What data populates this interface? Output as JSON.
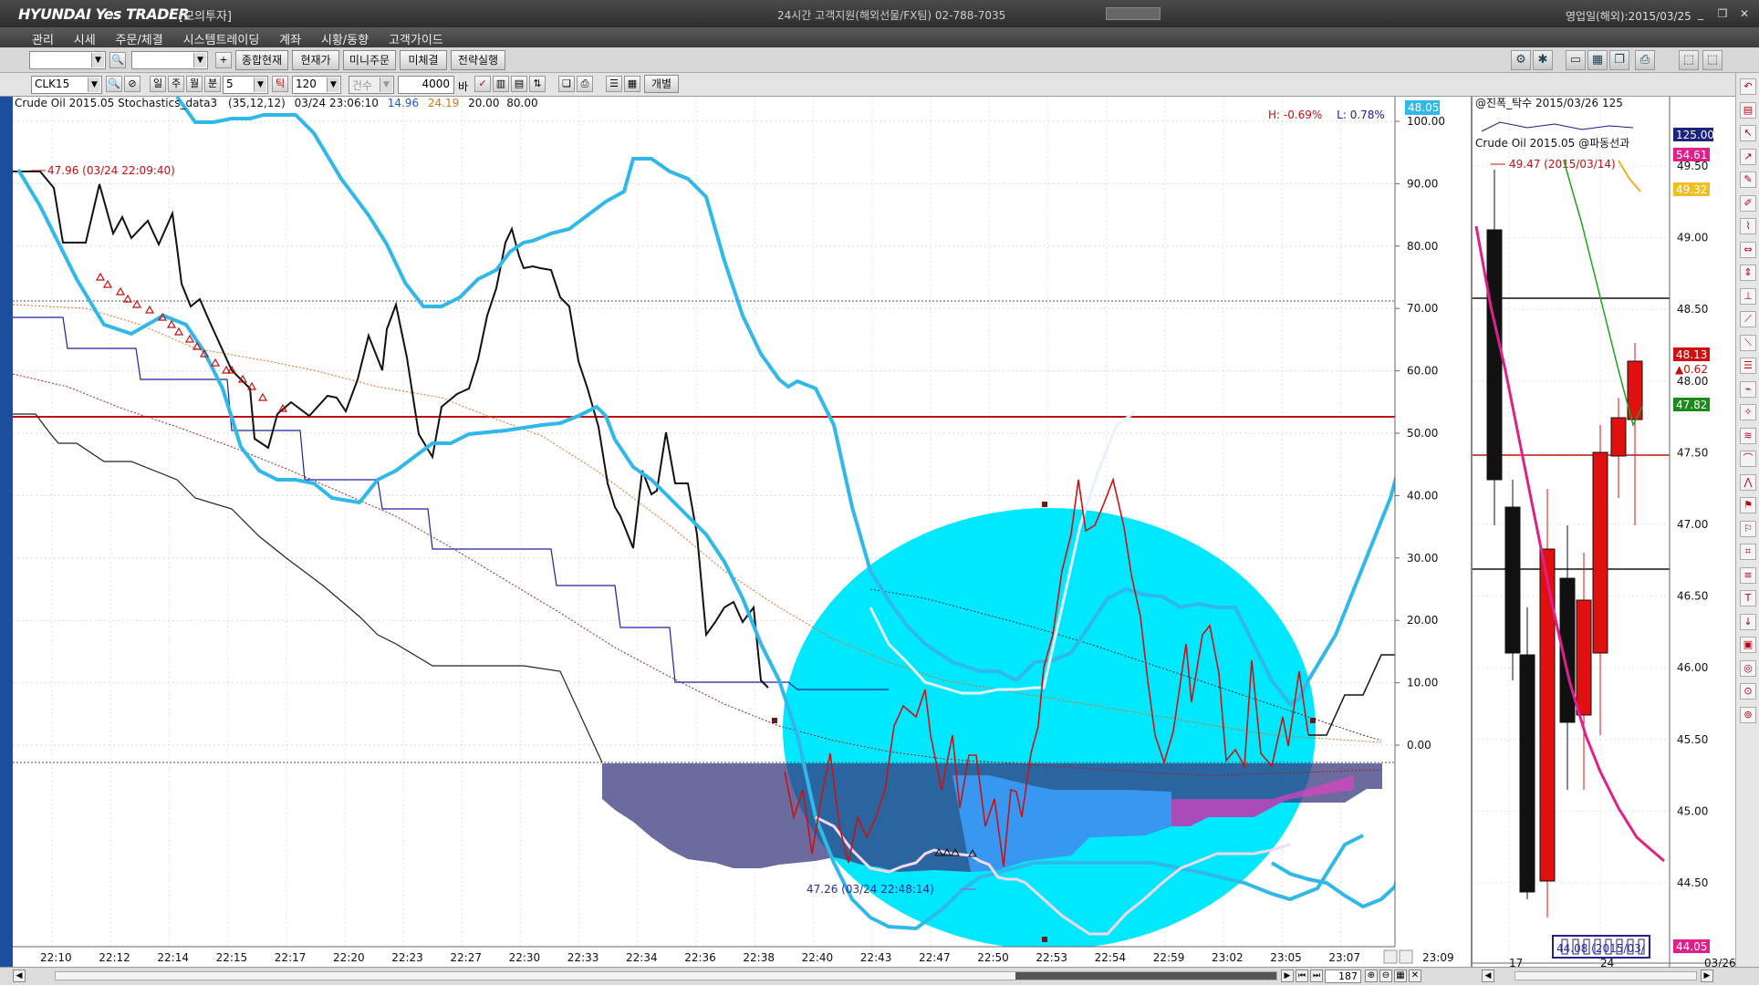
{
  "window": {
    "logo": "HYUNDAI Yes TRADER",
    "mode": "[모의투자]",
    "center_info": "24시간 고객지원(해외선물/FX팀) 02-788-7035",
    "right_info": "영업일(해외):2015/03/25",
    "minimize": "_",
    "restore": "❐",
    "close": "✕"
  },
  "menu": [
    "관리",
    "시세",
    "주문/체결",
    "시스템트레이딩",
    "계좌",
    "시황/동향",
    "고객가이드"
  ],
  "toolbar1": {
    "combo1": "",
    "combo2": "",
    "plus": "+",
    "buttons": [
      "종합현재",
      "현재가",
      "미니주문",
      "미체결",
      "전략실행"
    ]
  },
  "toolbar2": {
    "symbol": "CLK15",
    "periods": [
      "일",
      "주",
      "월",
      "분"
    ],
    "interval": "5",
    "tick": "틱",
    "count": "120",
    "volume_label": "건수",
    "qty": "4000",
    "qty_unit": "바",
    "individual": "개별"
  },
  "main_chart": {
    "header": {
      "title": "Crude Oil 2015.05 Stochastics_data3",
      "params": "(35,12,12)",
      "datetime": "03/24 23:06:10",
      "v1": "14.96",
      "v2": "24.19",
      "v3": "20.00",
      "v4": "80.00"
    },
    "hl": {
      "h": "H: -0.69%",
      "l": "L: 0.78%"
    },
    "max_label": "47.96 (03/24 22:09:40)",
    "min_label": "47.26 (03/24 22:48:14)",
    "current_badge": "48.05",
    "y_ticks": [
      "100.00",
      "90.00",
      "80.00",
      "70.00",
      "60.00",
      "50.00",
      "40.00",
      "30.00",
      "20.00",
      "10.00",
      "0.00"
    ],
    "x_ticks": [
      "22:10",
      "22:12",
      "22:14",
      "22:15",
      "22:17",
      "22:20",
      "22:23",
      "22:27",
      "22:30",
      "22:33",
      "22:34",
      "22:36",
      "22:38",
      "22:40",
      "22:43",
      "22:47",
      "22:50",
      "22:53",
      "22:54",
      "22:59",
      "23:02",
      "23:05",
      "23:07",
      "23:09"
    ],
    "colors": {
      "stoch": "#30b8e8",
      "price": "#111111",
      "red": "#cc1111",
      "cyan_circle": "#00e8ff",
      "navy": "#1a237e"
    }
  },
  "side_chart": {
    "header1": "@진폭_탁수  2015/03/26 125",
    "header2": "Crude Oil 2015.05 @파동선과",
    "max_label": "49.47 (2015/03/14)",
    "min_label": "44.08 (2015/03/",
    "badges": {
      "b125": "125.00",
      "b54": "54.61",
      "b49": "49.32",
      "b48": "48.13",
      "b062": "▲0.62",
      "b4782": "47.82",
      "b4405": "44.05"
    },
    "y_ticks": [
      "49.50",
      "49.00",
      "48.50",
      "48.00",
      "47.50",
      "47.00",
      "46.50",
      "46.00",
      "45.50",
      "45.00",
      "44.50"
    ],
    "x_ticks": [
      "17",
      "24",
      "03/26"
    ]
  },
  "status": {
    "count": "187"
  }
}
